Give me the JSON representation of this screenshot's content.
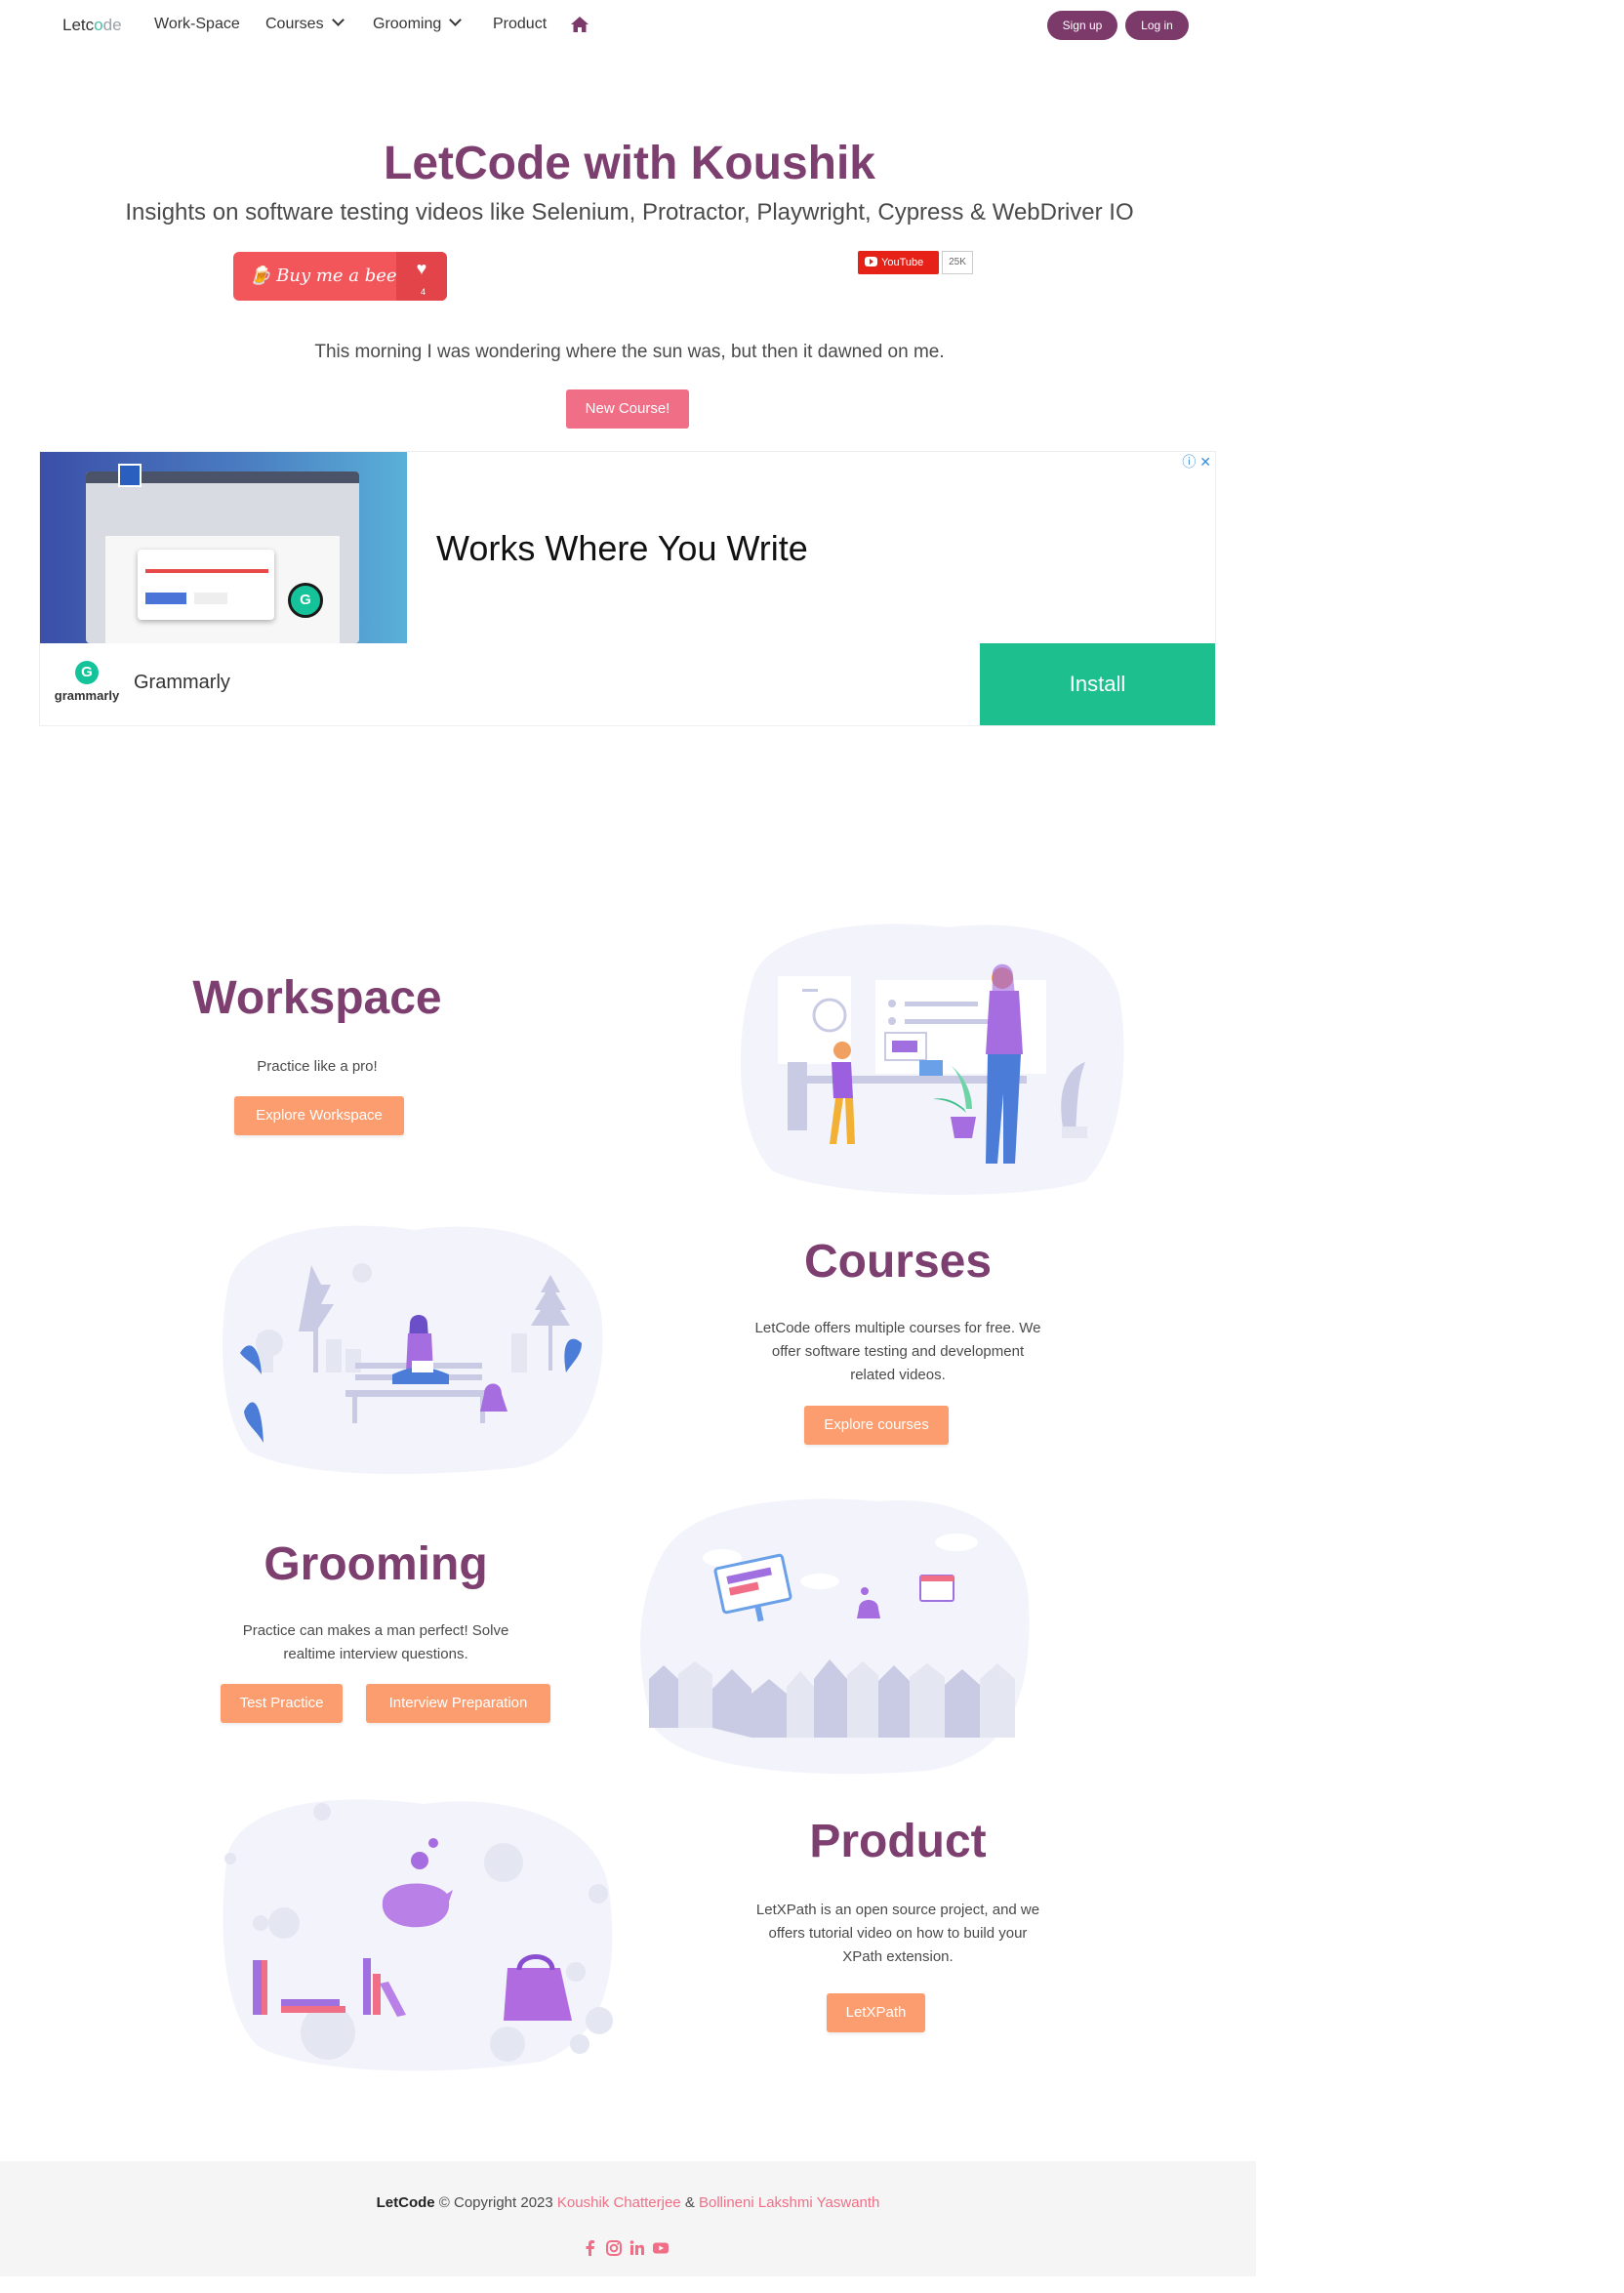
{
  "nav": {
    "brand_let": "Let",
    "brand_co": "c",
    "brand_o": "o",
    "brand_de": "de",
    "links": [
      "Work-Space",
      "Courses",
      "Grooming",
      "Product"
    ],
    "home_icon": "home-icon",
    "signup": "Sign up",
    "login": "Log in"
  },
  "hero": {
    "title": "LetCode with Koushik",
    "subtitle": "Insights on software testing videos like Selenium, Protractor, Playwright, Cypress & WebDriver IO",
    "beer_label": "Buy me a beer",
    "beer_count": "4",
    "youtube_label": "YouTube",
    "youtube_count": "25K",
    "quote": "This morning I was wondering where the sun was, but then it dawned on me.",
    "new_course": "New Course!"
  },
  "ad": {
    "headline": "Works Where You Write",
    "advertiser": "Grammarly",
    "logo_text": "grammarly",
    "install": "Install",
    "choices": "ⓘ ✕"
  },
  "sections": {
    "workspace": {
      "title": "Workspace",
      "text": "Practice like a pro!",
      "button": "Explore Workspace"
    },
    "courses": {
      "title": "Courses",
      "text_lines": [
        "LetCode offers multiple courses for free. We",
        "offer software testing and development",
        "related videos."
      ],
      "button": "Explore courses"
    },
    "grooming": {
      "title": "Grooming",
      "text_lines": [
        "Practice can makes a man perfect! Solve",
        "realtime interview questions."
      ],
      "button1": "Test Practice",
      "button2": "Interview Preparation"
    },
    "product": {
      "title": "Product",
      "text_lines": [
        "LetXPath is an open source project, and we",
        "offers tutorial video on how to build your",
        "XPath extension."
      ],
      "button": "LetXPath"
    }
  },
  "footer": {
    "brand": "LetCode",
    "copyright": " © Copyright 2023 ",
    "author1": "Koushik Chatterjee",
    "amp": " & ",
    "author2": "Bollineni Lakshmi Yaswanth",
    "social": [
      "facebook-icon",
      "instagram-icon",
      "linkedin-icon",
      "youtube-icon"
    ]
  },
  "colors": {
    "brand_purple": "#7d3f6f",
    "pill_purple": "#7b3a6a",
    "accent_pink": "#f06f87",
    "button_orange": "#fb9d6f",
    "ad_green": "#1dbf8f"
  }
}
